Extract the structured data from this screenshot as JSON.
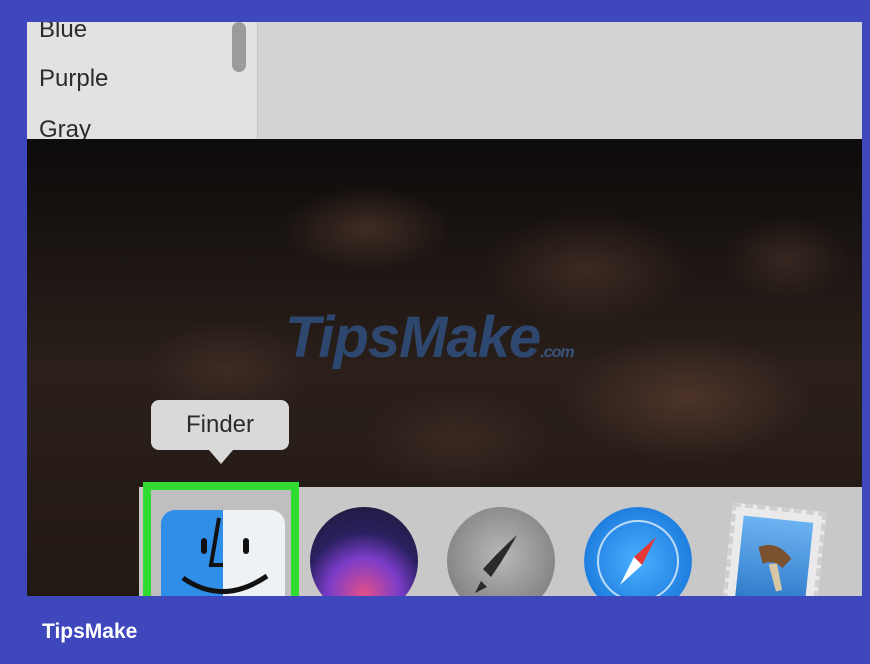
{
  "menu": {
    "items": [
      {
        "label": "Blue"
      },
      {
        "label": "Purple"
      },
      {
        "label": "Gray"
      }
    ]
  },
  "watermark": {
    "text": "TipsMake",
    "suffix": ".com"
  },
  "tooltip": {
    "label": "Finder"
  },
  "dock": {
    "items": [
      {
        "name": "Finder",
        "icon": "finder-icon",
        "highlighted": true
      },
      {
        "name": "Siri",
        "icon": "siri-icon"
      },
      {
        "name": "Launchpad",
        "icon": "launchpad-icon"
      },
      {
        "name": "Safari",
        "icon": "safari-icon"
      },
      {
        "name": "Mail",
        "icon": "mail-icon"
      }
    ]
  },
  "footer": {
    "brand": "TipsMake"
  },
  "colors": {
    "frame": "#3f47bd",
    "highlight": "#2fdc2f"
  }
}
